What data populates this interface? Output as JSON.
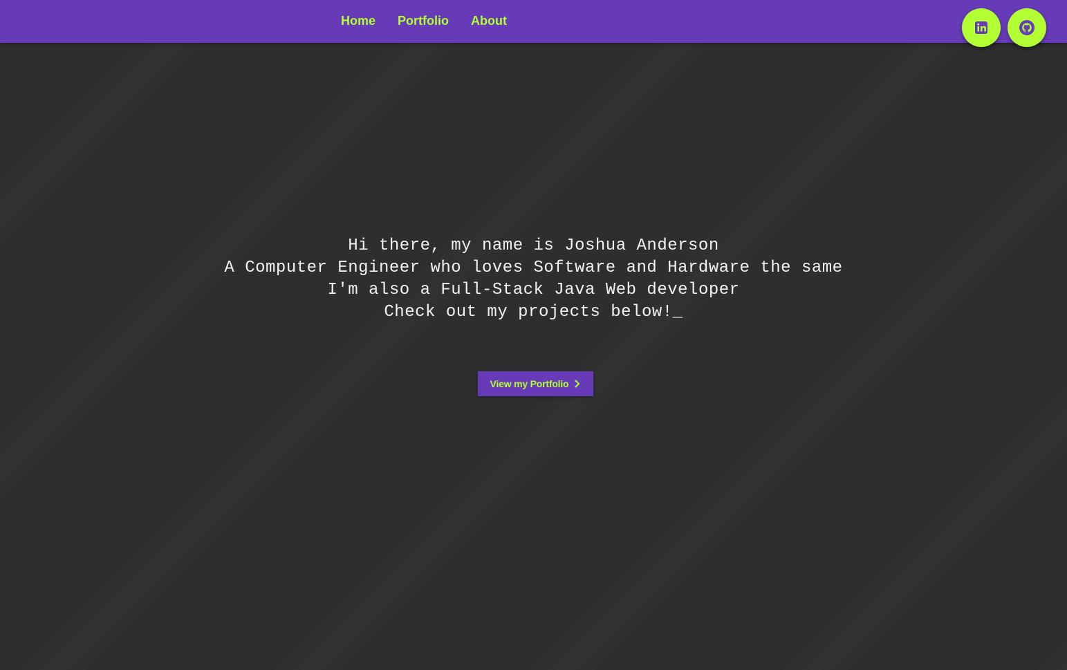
{
  "nav": {
    "links": [
      {
        "label": "Home"
      },
      {
        "label": "Portfolio"
      },
      {
        "label": "About"
      }
    ]
  },
  "social": {
    "linkedin_icon": "linkedin-icon",
    "github_icon": "github-icon"
  },
  "hero": {
    "lines": [
      "Hi there, my name is Joshua Anderson",
      "A Computer Engineer who loves Software and Hardware the same",
      "I'm also a Full-Stack Java Web developer",
      "Check out my projects below!"
    ],
    "cursor": "_"
  },
  "cta": {
    "label": "View my Portfolio",
    "icon": "chevron-right-icon"
  },
  "colors": {
    "primary": "#673ab7",
    "accent": "#b2ff33",
    "background": "#2e2e2e",
    "text": "#f2f2f2"
  }
}
